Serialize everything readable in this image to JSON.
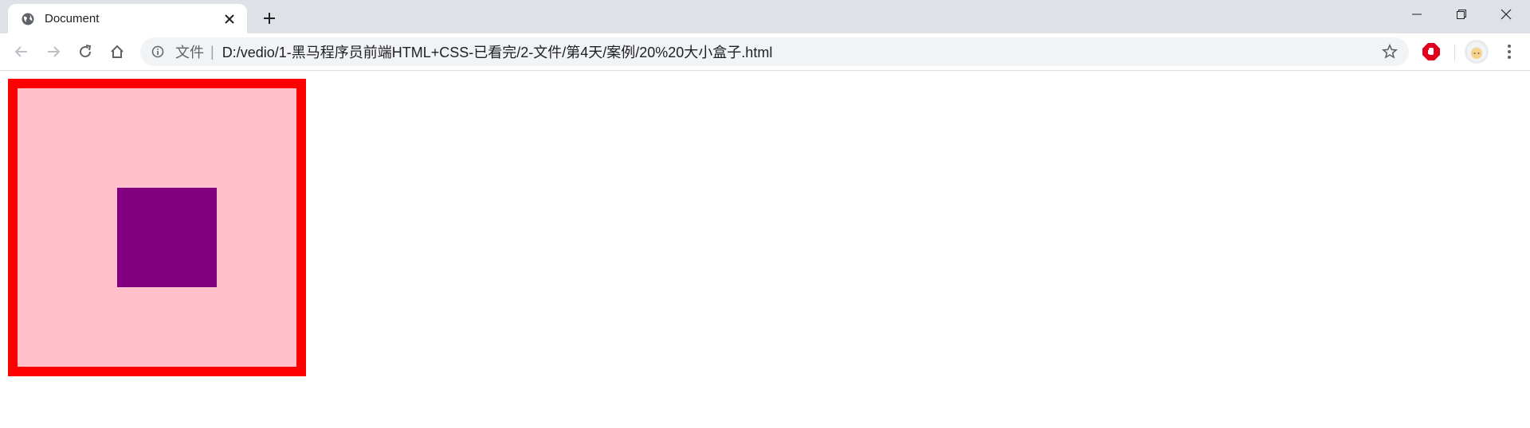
{
  "browser": {
    "tab": {
      "title": "Document",
      "favicon": "globe-icon"
    },
    "new_tab_icon": "plus-icon",
    "window_controls": [
      "minimize-icon",
      "restore-icon",
      "close-icon"
    ],
    "toolbar": {
      "nav_icons": [
        "back-arrow-icon",
        "forward-arrow-icon",
        "reload-icon",
        "home-icon"
      ],
      "omnibox": {
        "info_icon": "info-icon",
        "prefix": "文件",
        "separator": "|",
        "url": "D:/vedio/1-黑马程序员前端HTML+CSS-已看完/2-文件/第4天/案例/20%20大小盒子.html",
        "star_icon": "star-outline-icon"
      },
      "extension_icon": "adblock-hand-icon",
      "avatar_icon": "profile-avatar-icon",
      "menu_icon": "kebab-menu-icon"
    }
  },
  "page": {
    "outer_box": {
      "border_color": "#ff0000",
      "fill_color": "#ffc0cb"
    },
    "inner_box": {
      "fill_color": "#800080"
    }
  },
  "colors": {
    "tabstrip_bg": "#dee1e6",
    "omnibox_bg": "#f1f3f4",
    "adblock_red": "#e0001b"
  }
}
